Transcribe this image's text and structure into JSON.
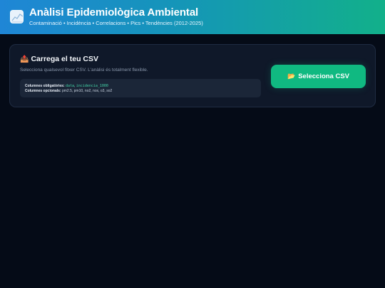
{
  "header": {
    "icon": "chart-icon",
    "title": "Anàlisi Epidemiològica Ambiental",
    "subtitle": "Contaminació • Incidència • Correlacions • Pics • Tendències (2012-2025)"
  },
  "upload": {
    "title_icon": "📤",
    "title": "Carrega el teu CSV",
    "description": "Selecciona qualsevol fitxer CSV. L'anàlisi és totalment flexible.",
    "required_label": "Columnes obligatòries:",
    "required_columns": [
      "data",
      "incidencia_1000"
    ],
    "optional_label": "Columnes opcionals:",
    "optional_columns": "pm2.5, pm10, no2, nox, o3, so2",
    "button_icon": "📂",
    "button_label": "Selecciona CSV"
  },
  "colors": {
    "accent": "#10b981",
    "header_gradient_start": "#1f86d6",
    "header_gradient_end": "#12b08a",
    "background": "#050b17",
    "card": "#0f1829"
  }
}
